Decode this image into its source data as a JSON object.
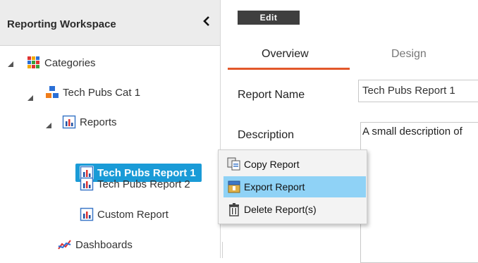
{
  "workspace": {
    "title": "Reporting Workspace"
  },
  "tree": {
    "categories": "Categories",
    "cat1": "Tech Pubs Cat 1",
    "reports": "Reports",
    "items": [
      "Tech Pubs Report 1",
      "Tech Pubs Report 2",
      "Custom Report"
    ],
    "dashboards": "Dashboards"
  },
  "toolbar": {
    "edit_label": "Edit"
  },
  "tabs": [
    {
      "label": "Overview"
    },
    {
      "label": "Design"
    }
  ],
  "form": {
    "name_label": "Report Name",
    "name_value": "Tech Pubs Report 1",
    "desc_label": "Description",
    "desc_value": "A small description of"
  },
  "context_menu": {
    "items": [
      {
        "label": "Copy Report"
      },
      {
        "label": "Export Report"
      },
      {
        "label": "Delete Report(s)"
      }
    ]
  },
  "colors": {
    "selection": "#1a9bd7",
    "menu_highlight": "#8fd2f6",
    "tab_accent": "#e2572a"
  }
}
